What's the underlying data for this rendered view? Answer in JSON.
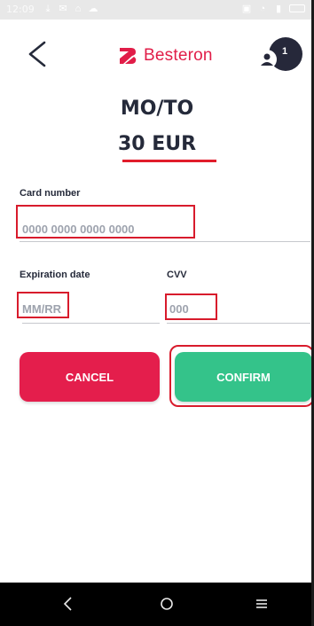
{
  "status_bar": {
    "time": "12:09"
  },
  "header": {
    "brand_name": "Besteron",
    "brand_color": "#e11d48",
    "user_count": "1"
  },
  "main": {
    "title": "MO/TO",
    "amount": "30 EUR"
  },
  "form": {
    "card_number": {
      "label": "Card number",
      "placeholder": "0000 0000 0000 0000"
    },
    "expiration": {
      "label": "Expiration date",
      "placeholder": "MM/RR"
    },
    "cvv": {
      "label": "CVV",
      "placeholder": "000"
    }
  },
  "buttons": {
    "cancel": "CANCEL",
    "confirm": "CONFIRM",
    "cancel_color": "#e41e4c",
    "confirm_color": "#34c38a"
  },
  "nav": {
    "icons": [
      "back-icon",
      "home-icon",
      "menu-icon"
    ]
  }
}
